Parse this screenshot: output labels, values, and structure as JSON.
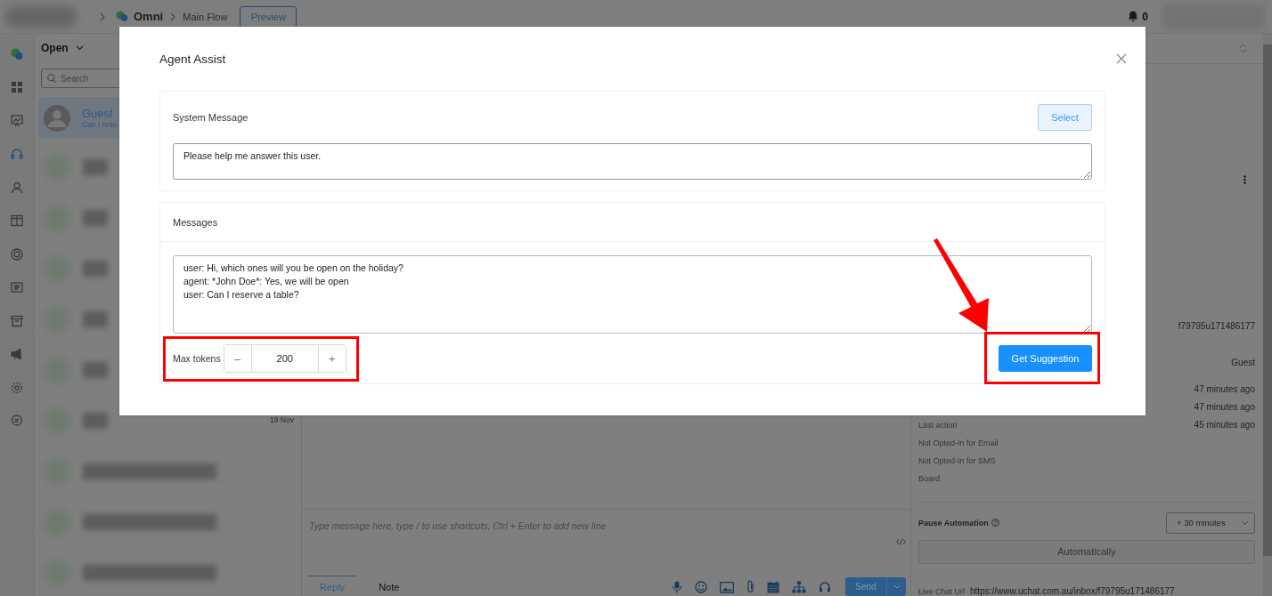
{
  "topbar": {
    "breadcrumb": [
      "Omni",
      "Main Flow"
    ],
    "preview_button": "Preview",
    "notifications": "0"
  },
  "rail": {
    "items": [
      {
        "kind": "chat",
        "selected": false
      },
      {
        "kind": "grid",
        "selected": false
      },
      {
        "kind": "chart",
        "selected": false
      },
      {
        "kind": "headset",
        "selected": true
      },
      {
        "kind": "user",
        "selected": false
      },
      {
        "kind": "columns",
        "selected": false
      },
      {
        "kind": "globe",
        "selected": false
      },
      {
        "kind": "card",
        "selected": false
      },
      {
        "kind": "archive",
        "selected": false
      },
      {
        "kind": "megaphone",
        "selected": false
      },
      {
        "kind": "gear",
        "selected": false
      },
      {
        "kind": "comment",
        "selected": false
      }
    ]
  },
  "conversations": {
    "filter": "Open",
    "search": {
      "placeholder": "Search"
    },
    "items": [
      {
        "kind": "contact",
        "name": "Guest",
        "preview": "Can I rese",
        "selected": true
      },
      {
        "kind": "blurred",
        "selected": false
      },
      {
        "kind": "blurred",
        "selected": false
      },
      {
        "kind": "blurred",
        "selected": false
      },
      {
        "kind": "blurred",
        "selected": false
      },
      {
        "kind": "blurred",
        "selected": false
      },
      {
        "kind": "blurred",
        "selected": false,
        "date": "19 Nov"
      },
      {
        "kind": "blurred",
        "selected": false
      },
      {
        "kind": "blurred",
        "selected": false
      },
      {
        "kind": "blurred",
        "selected": false
      }
    ]
  },
  "chat": {
    "composer": {
      "placeholder": "Type message here, type / to use shortcuts, Ctrl + Enter to add new line"
    },
    "tabs": [
      {
        "label": "Reply",
        "selected": true
      },
      {
        "label": "Note",
        "selected": false
      }
    ],
    "send_button": "Send"
  },
  "details": {
    "rows": [
      {
        "value": "f79795u171486177"
      },
      {
        "value": "Guest"
      },
      {
        "value": "47 minutes ago"
      },
      {
        "value": "47 minutes ago"
      },
      {
        "label": "Last action",
        "value": "45 minutes ago"
      },
      {
        "label": "Not Opted-In for Email"
      },
      {
        "label": "Not Opted-In for SMS"
      },
      {
        "label": "Board"
      }
    ],
    "pause_automation": {
      "label": "Pause Automation",
      "duration": "+ 30 minutes"
    },
    "automatically_button": "Automatically",
    "live_chat_url": {
      "label": "Live Chat Url",
      "value": "https://www.uchat.com.au/inbox/f79795u171486177"
    }
  },
  "dialog": {
    "title": "Agent Assist",
    "system_message": {
      "label": "System Message",
      "select_button": "Select",
      "value": "Please help me answer this user."
    },
    "messages": {
      "label": "Messages",
      "value": "user: Hi, which ones will you be open on the holiday?\nagent: *John Doe*: Yes, we will be open\nuser: Can I reserve a table?"
    },
    "max_tokens": {
      "label": "Max tokens",
      "decrement": "–",
      "value": "200",
      "increment": "+"
    },
    "get_suggestion_button": "Get Suggestion"
  }
}
